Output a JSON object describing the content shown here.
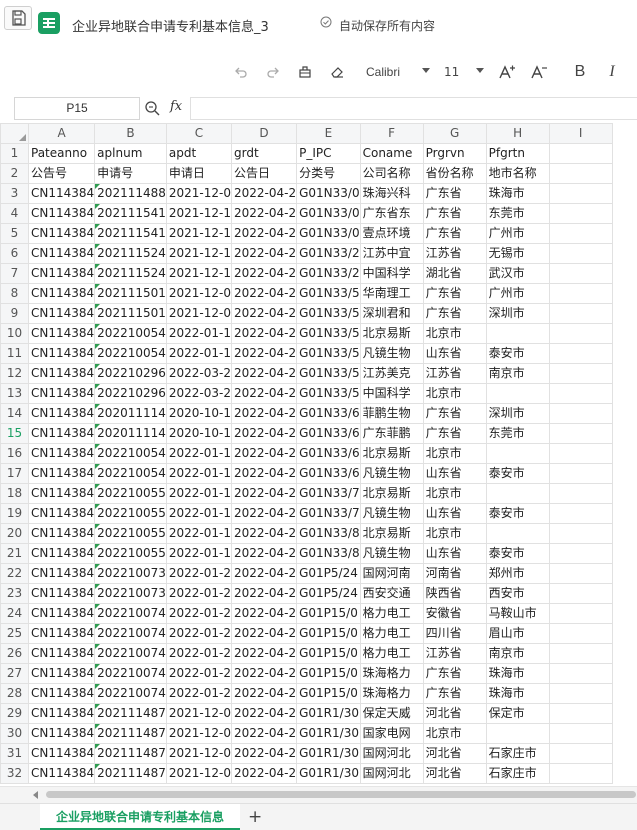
{
  "titlebar": {
    "doc_title": "企业异地联合申请专利基本信息_3",
    "autosave": "自动保存所有内容",
    "brand_color": "#1a9f62"
  },
  "toolbar": {
    "font_name": "Calibri",
    "font_size": "11",
    "bold": "B",
    "italic": "I"
  },
  "formula_bar": {
    "cell_ref": "P15",
    "fx": "fx"
  },
  "grid": {
    "columns": [
      "A",
      "B",
      "C",
      "D",
      "E",
      "F",
      "G",
      "H",
      "I"
    ],
    "active_row": "15",
    "rows": [
      {
        "n": "1",
        "cells": [
          "Pateanno",
          "aplnum",
          "apdt",
          "grdt",
          "P_IPC",
          "Coname",
          "Prgrvn",
          "Pfgrtn",
          ""
        ]
      },
      {
        "n": "2",
        "cells": [
          "公告号",
          "申请号",
          "申请日",
          "公告日",
          "分类号",
          "公司名称",
          "省份名称",
          "地市名称",
          ""
        ]
      },
      {
        "n": "3",
        "cells": [
          "CN114384",
          "202111488",
          "2021-12-0",
          "2022-04-2",
          "G01N33/0",
          "珠海兴科",
          "广东省",
          "珠海市",
          ""
        ]
      },
      {
        "n": "4",
        "cells": [
          "CN114384",
          "202111541",
          "2021-12-1",
          "2022-04-2",
          "G01N33/0",
          "广东省东",
          "广东省",
          "东莞市",
          ""
        ]
      },
      {
        "n": "5",
        "cells": [
          "CN114384",
          "202111541",
          "2021-12-1",
          "2022-04-2",
          "G01N33/0",
          "壹点环境",
          "广东省",
          "广州市",
          ""
        ]
      },
      {
        "n": "6",
        "cells": [
          "CN114384",
          "202111524",
          "2021-12-1",
          "2022-04-2",
          "G01N33/2",
          "江苏中宜",
          "江苏省",
          "无锡市",
          ""
        ]
      },
      {
        "n": "7",
        "cells": [
          "CN114384",
          "202111524",
          "2021-12-1",
          "2022-04-2",
          "G01N33/2",
          "中国科学",
          "湖北省",
          "武汉市",
          ""
        ]
      },
      {
        "n": "8",
        "cells": [
          "CN114384",
          "202111501",
          "2021-12-0",
          "2022-04-2",
          "G01N33/5",
          "华南理工",
          "广东省",
          "广州市",
          ""
        ]
      },
      {
        "n": "9",
        "cells": [
          "CN114384",
          "202111501",
          "2021-12-0",
          "2022-04-2",
          "G01N33/5",
          "深圳君和",
          "广东省",
          "深圳市",
          ""
        ]
      },
      {
        "n": "10",
        "cells": [
          "CN114384",
          "202210054",
          "2022-01-1",
          "2022-04-2",
          "G01N33/5",
          "北京易斯",
          "北京市",
          "",
          ""
        ]
      },
      {
        "n": "11",
        "cells": [
          "CN114384",
          "202210054",
          "2022-01-1",
          "2022-04-2",
          "G01N33/5",
          "凡镜生物",
          "山东省",
          "泰安市",
          ""
        ]
      },
      {
        "n": "12",
        "cells": [
          "CN114384",
          "202210296",
          "2022-03-2",
          "2022-04-2",
          "G01N33/5",
          "江苏美克",
          "江苏省",
          "南京市",
          ""
        ]
      },
      {
        "n": "13",
        "cells": [
          "CN114384",
          "202210296",
          "2022-03-2",
          "2022-04-2",
          "G01N33/5",
          "中国科学",
          "北京市",
          "",
          ""
        ]
      },
      {
        "n": "14",
        "cells": [
          "CN114384",
          "202011114",
          "2020-10-1",
          "2022-04-2",
          "G01N33/6",
          "菲鹏生物",
          "广东省",
          "深圳市",
          ""
        ]
      },
      {
        "n": "15",
        "cells": [
          "CN114384",
          "202011114",
          "2020-10-1",
          "2022-04-2",
          "G01N33/6",
          "广东菲鹏",
          "广东省",
          "东莞市",
          ""
        ]
      },
      {
        "n": "16",
        "cells": [
          "CN114384",
          "202210054",
          "2022-01-1",
          "2022-04-2",
          "G01N33/6",
          "北京易斯",
          "北京市",
          "",
          ""
        ]
      },
      {
        "n": "17",
        "cells": [
          "CN114384",
          "202210054",
          "2022-01-1",
          "2022-04-2",
          "G01N33/6",
          "凡镜生物",
          "山东省",
          "泰安市",
          ""
        ]
      },
      {
        "n": "18",
        "cells": [
          "CN114384",
          "202210055",
          "2022-01-1",
          "2022-04-2",
          "G01N33/7",
          "北京易斯",
          "北京市",
          "",
          ""
        ]
      },
      {
        "n": "19",
        "cells": [
          "CN114384",
          "202210055",
          "2022-01-1",
          "2022-04-2",
          "G01N33/7",
          "凡镜生物",
          "山东省",
          "泰安市",
          ""
        ]
      },
      {
        "n": "20",
        "cells": [
          "CN114384",
          "202210055",
          "2022-01-1",
          "2022-04-2",
          "G01N33/8",
          "北京易斯",
          "北京市",
          "",
          ""
        ]
      },
      {
        "n": "21",
        "cells": [
          "CN114384",
          "202210055",
          "2022-01-1",
          "2022-04-2",
          "G01N33/8",
          "凡镜生物",
          "山东省",
          "泰安市",
          ""
        ]
      },
      {
        "n": "22",
        "cells": [
          "CN114384",
          "202210073",
          "2022-01-2",
          "2022-04-2",
          "G01P5/24",
          "国网河南",
          "河南省",
          "郑州市",
          ""
        ]
      },
      {
        "n": "23",
        "cells": [
          "CN114384",
          "202210073",
          "2022-01-2",
          "2022-04-2",
          "G01P5/24",
          "西安交通",
          "陕西省",
          "西安市",
          ""
        ]
      },
      {
        "n": "24",
        "cells": [
          "CN114384",
          "202210074",
          "2022-01-2",
          "2022-04-2",
          "G01P15/0",
          "格力电工",
          "安徽省",
          "马鞍山市",
          ""
        ]
      },
      {
        "n": "25",
        "cells": [
          "CN114384",
          "202210074",
          "2022-01-2",
          "2022-04-2",
          "G01P15/0",
          "格力电工",
          "四川省",
          "眉山市",
          ""
        ]
      },
      {
        "n": "26",
        "cells": [
          "CN114384",
          "202210074",
          "2022-01-2",
          "2022-04-2",
          "G01P15/0",
          "格力电工",
          "江苏省",
          "南京市",
          ""
        ]
      },
      {
        "n": "27",
        "cells": [
          "CN114384",
          "202210074",
          "2022-01-2",
          "2022-04-2",
          "G01P15/0",
          "珠海格力",
          "广东省",
          "珠海市",
          ""
        ]
      },
      {
        "n": "28",
        "cells": [
          "CN114384",
          "202210074",
          "2022-01-2",
          "2022-04-2",
          "G01P15/0",
          "珠海格力",
          "广东省",
          "珠海市",
          ""
        ]
      },
      {
        "n": "29",
        "cells": [
          "CN114384",
          "202111487",
          "2021-12-0",
          "2022-04-2",
          "G01R1/30",
          "保定天威",
          "河北省",
          "保定市",
          ""
        ]
      },
      {
        "n": "30",
        "cells": [
          "CN114384",
          "202111487",
          "2021-12-0",
          "2022-04-2",
          "G01R1/30",
          "国家电网",
          "北京市",
          "",
          ""
        ]
      },
      {
        "n": "31",
        "cells": [
          "CN114384",
          "202111487",
          "2021-12-0",
          "2022-04-2",
          "G01R1/30",
          "国网河北",
          "河北省",
          "石家庄市",
          ""
        ]
      },
      {
        "n": "32",
        "cells": [
          "CN114384",
          "202111487",
          "2021-12-0",
          "2022-04-2",
          "G01R1/30",
          "国网河北",
          "河北省",
          "石家庄市",
          ""
        ]
      }
    ]
  },
  "sheet_tabs": {
    "active": "企业异地联合申请专利基本信息",
    "add_label": "+"
  }
}
